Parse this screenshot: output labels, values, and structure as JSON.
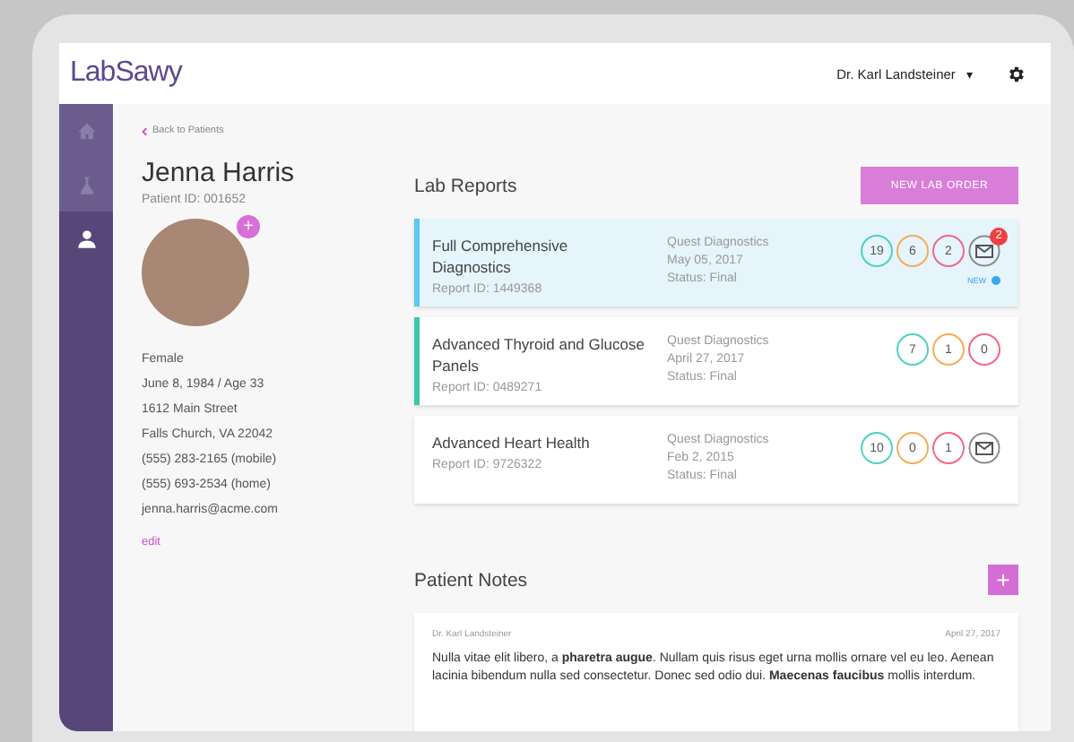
{
  "header": {
    "logo": "LabSawy",
    "user": "Dr. Karl Landsteiner",
    "caret": "▾"
  },
  "nav": [
    {
      "selected": false
    },
    {
      "selected": false
    },
    {
      "selected": true
    }
  ],
  "patient": {
    "back": "Back to Patients",
    "name": "Jenna Harris",
    "patient_id": "Patient ID: 001652",
    "avatar_add": "+",
    "details": [
      "Female",
      "June 8, 1984 / Age 33",
      "1612 Main Street",
      "Falls Church, VA 22042",
      "(555) 283-2165 (mobile)",
      "(555) 693-2534 (home)",
      "jenna.harris@acme.com"
    ],
    "edit": "edit"
  },
  "lab_reports": {
    "title": "Lab Reports",
    "button": "NEW LAB ORDER",
    "reports": [
      {
        "name": "Full Comprehensive Diagnostics",
        "report_id": "Report ID: 1449368",
        "lab": "Quest Diagnostics",
        "date": "May 05, 2017",
        "status": "Status: Final",
        "selected": true,
        "color": "#5cc8f0",
        "mail": true,
        "mail_badge": "2",
        "new_label": "NEW",
        "counts": [
          {
            "value": "19",
            "color": "#4fd1c5"
          },
          {
            "value": "6",
            "color": "#f6ad55"
          },
          {
            "value": "2",
            "color": "#f56689"
          }
        ]
      },
      {
        "name": "Advanced Thyroid and Glucose Panels",
        "report_id": "Report ID: 0489271",
        "lab": "Quest Diagnostics",
        "date": "April 27, 2017",
        "status": "Status: Final",
        "selected": false,
        "color": "#38c9a8",
        "mail": false,
        "counts": [
          {
            "value": "7",
            "color": "#4fd1c5"
          },
          {
            "value": "1",
            "color": "#f6ad55"
          },
          {
            "value": "0",
            "color": "#f56689"
          }
        ]
      },
      {
        "name": "Advanced Heart Health",
        "report_id": "Report ID: 9726322",
        "lab": "Quest Diagnostics",
        "date": "Feb 2, 2015",
        "status": "Status: Final",
        "selected": false,
        "mail": true,
        "counts": [
          {
            "value": "10",
            "color": "#4fd1c5"
          },
          {
            "value": "0",
            "color": "#f6ad55"
          },
          {
            "value": "1",
            "color": "#f56689"
          }
        ]
      }
    ]
  },
  "patient_notes": {
    "title": "Patient Notes",
    "add": "+",
    "notes": [
      {
        "author": "Dr. Karl Landsteiner",
        "date": "April 27, 2017",
        "text": "Nulla vitae elit libero, a **pharetra augue**. Nullam quis risus eget urna mollis ornare vel eu leo. Aenean lacinia bibendum nulla sed consectetur. Donec sed odio dui. **Maecenas faucibus** mollis interdum."
      }
    ]
  }
}
